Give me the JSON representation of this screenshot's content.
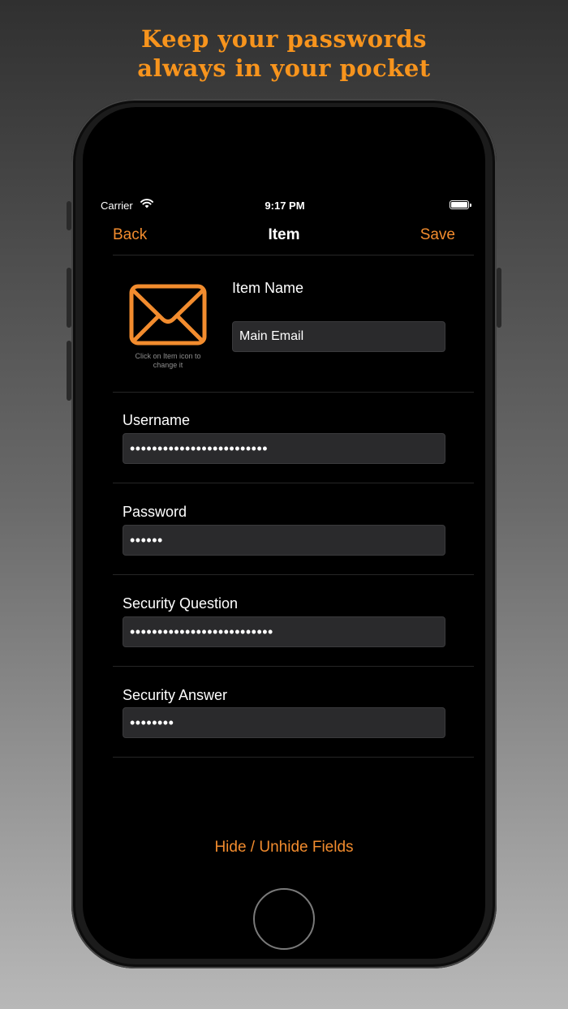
{
  "promo": {
    "line1": "Keep your passwords",
    "line2": "always in your pocket"
  },
  "status_bar": {
    "carrier": "Carrier",
    "time": "9:17 PM"
  },
  "nav": {
    "back_label": "Back",
    "title": "Item",
    "save_label": "Save"
  },
  "item": {
    "icon": "envelope-icon",
    "icon_hint": "Click on Item icon to change it",
    "name_label": "Item Name",
    "name_value": "Main Email"
  },
  "fields": {
    "username_label": "Username",
    "username_value": "•••••••••••••••••••••••••",
    "password_label": "Password",
    "password_value": "••••••",
    "security_question_label": "Security Question",
    "security_question_value": "••••••••••••••••••••••••••",
    "security_answer_label": "Security Answer",
    "security_answer_value": "••••••••"
  },
  "footer": {
    "toggle_label": "Hide / Unhide Fields"
  },
  "colors": {
    "accent": "#f28c2e",
    "headline": "#f7941d",
    "background": "#000000",
    "field_bg": "#2a2a2c"
  }
}
